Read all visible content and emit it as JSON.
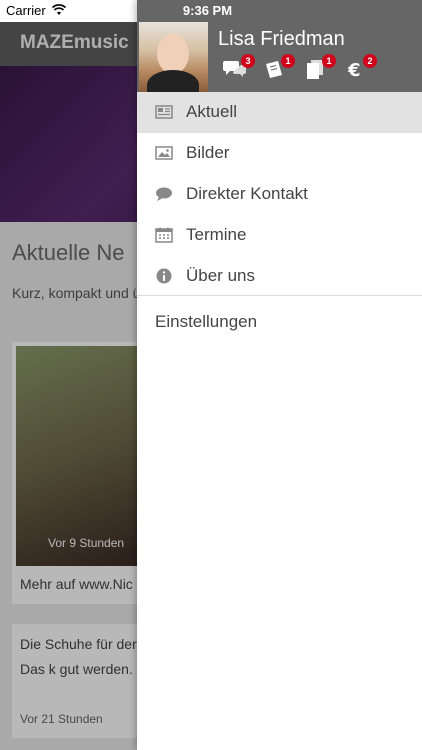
{
  "status_bar": {
    "carrier": "Carrier",
    "time": "9:36 PM"
  },
  "background": {
    "app_title": "MAZEmusic",
    "heading": "Aktuelle Ne",
    "subtitle": "Kurz, kompakt und über aktuelle Theme",
    "card1_time": "Vor 9 Stunden",
    "card1_more": "Mehr auf www.Nic",
    "card2_text": "Die Schuhe für der Gig sind da! Das k gut werden. 😂☺",
    "card2_time": "Vor 21 Stunden"
  },
  "drawer": {
    "user_name": "Lisa Friedman",
    "badges": [
      {
        "icon": "chat-bubbles-icon",
        "count": "3"
      },
      {
        "icon": "tickets-icon",
        "count": "1"
      },
      {
        "icon": "documents-icon",
        "count": "1"
      },
      {
        "icon": "euro-icon",
        "count": "2"
      }
    ],
    "menu": [
      {
        "label": "Aktuell",
        "icon": "newspaper-icon",
        "active": true
      },
      {
        "label": "Bilder",
        "icon": "image-icon",
        "active": false
      },
      {
        "label": "Direkter Kontakt",
        "icon": "chat-bubble-icon",
        "active": false
      },
      {
        "label": "Termine",
        "icon": "calendar-icon",
        "active": false
      },
      {
        "label": "Über uns",
        "icon": "info-icon",
        "active": false
      }
    ],
    "settings_label": "Einstellungen"
  },
  "colors": {
    "header_gray": "#666666",
    "active_row": "#e2e2e2",
    "badge_red": "#d0021b"
  }
}
